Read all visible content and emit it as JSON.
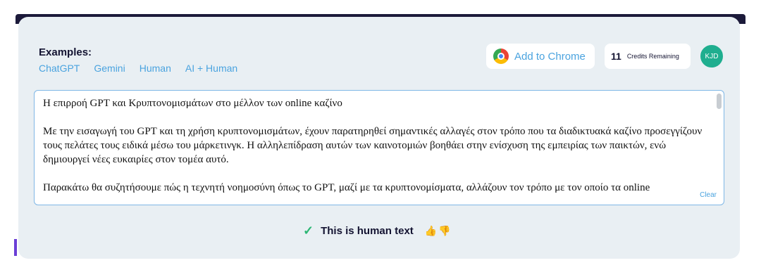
{
  "examples": {
    "title": "Examples:",
    "links": [
      "ChatGPT",
      "Gemini",
      "Human",
      "AI + Human"
    ]
  },
  "header": {
    "add_to_chrome": "Add to Chrome",
    "credits_count": "11",
    "credits_label": "Credits Remaining",
    "avatar_initials": "KJD"
  },
  "editor": {
    "paragraphs": [
      "Η επιρροή GPT και Κρυπτονομισμάτων στο μέλλον των online καζίνο",
      "Με την εισαγωγή του GPT και τη χρήση κρυπτονομισμάτων, έχουν παρατηρηθεί σημαντικές αλλαγές στον τρόπο που τα διαδικτυακά καζίνο προσεγγίζουν τους πελάτες τους ειδικά μέσω του μάρκετινγκ. Η αλληλεπίδραση αυτών των καινοτομιών βοηθάει στην ενίσχυση της εμπειρίας των παικτών, ενώ δημιουργεί νέες ευκαιρίες στον τομέα αυτό.",
      "Παρακάτω θα συζητήσουμε πώς η τεχνητή νοημοσύνη όπως το GPT, μαζί με τα κρυπτονομίσματα, αλλάζουν τον τρόπο με τον οποίο τα online"
    ],
    "clear_label": "Clear"
  },
  "result": {
    "verdict": "This is human text",
    "check_icon": "check-icon",
    "thumb_up_icon": "thumb-up-icon",
    "thumb_down_icon": "thumb-down-icon"
  },
  "colors": {
    "accent": "#4aa3df",
    "success": "#2bb673",
    "avatar_bg": "#1fae8f",
    "card_bg": "#e9eff3"
  }
}
